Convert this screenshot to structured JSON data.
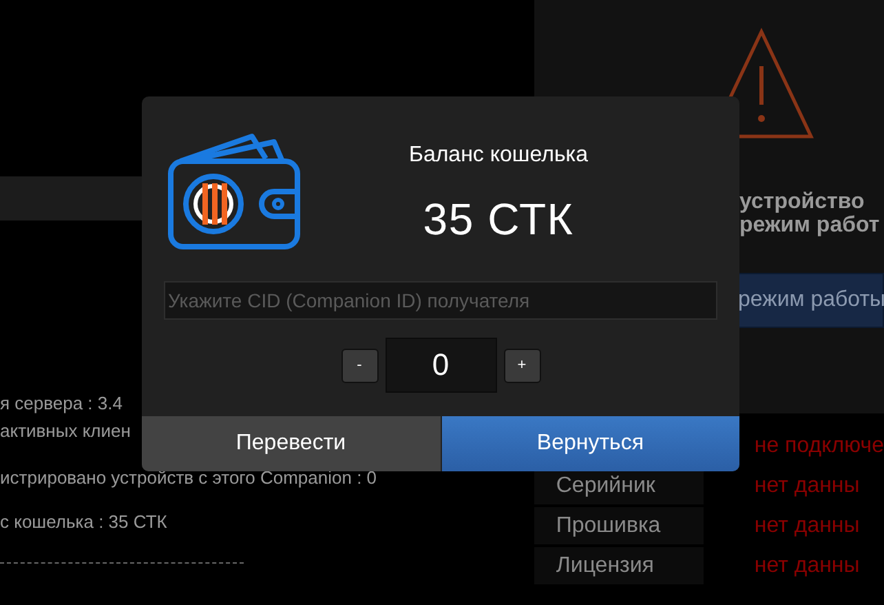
{
  "background": {
    "info_lines": [
      "я сервера : 3.4",
      "активных клиен",
      "истрировано устройств с этого Companion : 0",
      "с кошелька : 35 СТК"
    ],
    "warning": {
      "lines": [
        "устройство",
        "режим работ"
      ],
      "button": "режим работы"
    },
    "status_rows": [
      {
        "label": "",
        "value": "не подключе"
      },
      {
        "label": "Серийник",
        "value": "нет данны"
      },
      {
        "label": "Прошивка",
        "value": "нет данны"
      },
      {
        "label": "Лицензия",
        "value": "нет данны"
      }
    ]
  },
  "dialog": {
    "title": "Баланс кошелька",
    "balance": "35 СТК",
    "recipient": {
      "placeholder": "Укажите CID (Companion ID) получателя"
    },
    "amount": {
      "value": "0",
      "decrement": "-",
      "increment": "+"
    },
    "buttons": [
      {
        "label": "Перевести",
        "kind": "secondary"
      },
      {
        "label": "Вернуться",
        "kind": "primary"
      }
    ]
  }
}
